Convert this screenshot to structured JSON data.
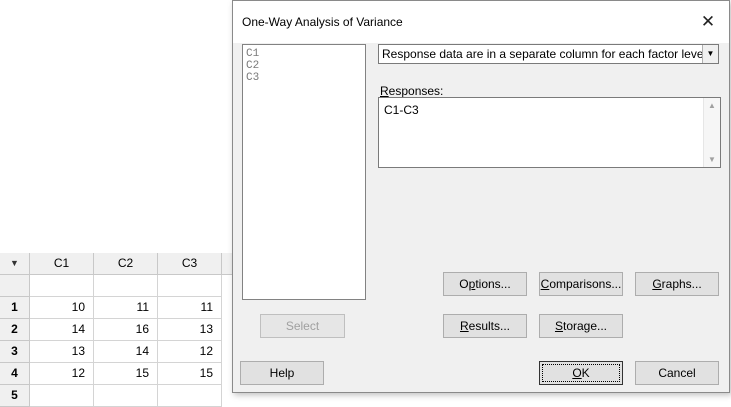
{
  "worksheet": {
    "corner_icon": "down-arrow-icon",
    "columns": [
      "C1",
      "C2",
      "C3"
    ],
    "rows": [
      {
        "num": "1",
        "values": [
          "10",
          "11",
          "11"
        ]
      },
      {
        "num": "2",
        "values": [
          "14",
          "16",
          "13"
        ]
      },
      {
        "num": "3",
        "values": [
          "13",
          "14",
          "12"
        ]
      },
      {
        "num": "4",
        "values": [
          "12",
          "15",
          "15"
        ]
      },
      {
        "num": "5",
        "values": [
          "",
          "",
          ""
        ]
      }
    ]
  },
  "dialog": {
    "title": "One-Way Analysis of Variance",
    "close_icon": "close-icon",
    "variables": [
      "C1",
      "C2",
      "C3"
    ],
    "data_format": "Response data are in a separate column for each factor level",
    "responses_label": "Responses:",
    "responses_value": "C1-C3",
    "buttons": {
      "select": "Select",
      "options": "Options...",
      "comparisons": "Comparisons...",
      "graphs": "Graphs...",
      "results": "Results...",
      "storage": "Storage...",
      "help": "Help",
      "ok": "OK",
      "cancel": "Cancel"
    }
  }
}
